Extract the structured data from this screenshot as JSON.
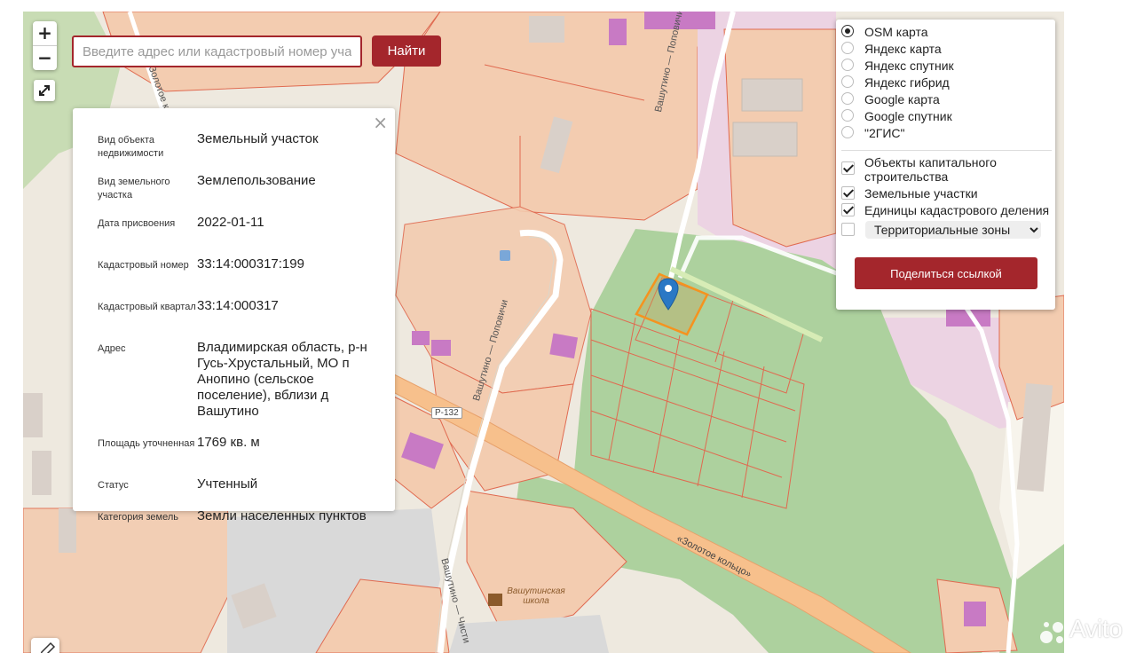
{
  "search": {
    "placeholder": "Введите адрес или кадастровый номер участка",
    "button_label": "Найти"
  },
  "zoom": {
    "in_label": "+",
    "out_label": "−"
  },
  "info_card": {
    "rows": [
      {
        "label": "Вид объекта недвижимости",
        "value": "Земельный участок"
      },
      {
        "label": "Вид земельного участка",
        "value": "Землепользование"
      },
      {
        "label": "Дата присвоения",
        "value": "2022-01-11"
      },
      {
        "label": "Кадастровый номер",
        "value": "33:14:000317:199"
      },
      {
        "label": "Кадастровый квартал",
        "value": "33:14:000317"
      },
      {
        "label": "Адрес",
        "value": "Владимирская область, р-н Гусь-Хрустальный, МО п Анопино (сельское поселение), вблизи д Вашутино"
      },
      {
        "label": "Площадь уточненная",
        "value": "1769 кв. м"
      },
      {
        "label": "Статус",
        "value": "Учтенный"
      },
      {
        "label": "Категория земель",
        "value": "Земли населенных пунктов"
      }
    ]
  },
  "layers": {
    "base_maps": [
      {
        "label": "OSM карта",
        "selected": true
      },
      {
        "label": "Яндекс карта",
        "selected": false
      },
      {
        "label": "Яндекс спутник",
        "selected": false
      },
      {
        "label": "Яндекс гибрид",
        "selected": false
      },
      {
        "label": "Google карта",
        "selected": false
      },
      {
        "label": "Google спутник",
        "selected": false
      },
      {
        "label": "\"2ГИС\"",
        "selected": false
      }
    ],
    "overlays": [
      {
        "label": "Объекты капитального строительства",
        "checked": true
      },
      {
        "label": "Земельные участки",
        "checked": true
      },
      {
        "label": "Единицы кадастрового деления",
        "checked": true
      },
      {
        "label": "Территориальные зоны",
        "checked": false
      }
    ],
    "share_label": "Поделиться ссылкой"
  },
  "map_labels": {
    "street1": "Вашутино — Поповичи",
    "street2": "Вашутино — Поповичи",
    "street3": "Вашутино — Чисти",
    "road_number": "Р-132",
    "road_name": "«Золотое кольцо»",
    "school": "Вашутинская школа",
    "top_street": "Золотое кольцо"
  },
  "watermark": "Avito",
  "colors": {
    "accent": "#a4262c",
    "parcel_fill": "#f3ccb0",
    "parcel_stroke": "#e06a50",
    "forest": "#add19e",
    "building": "#d9d0c9",
    "selected_parcel": "#f5931f",
    "marker": "#2a78c5"
  }
}
